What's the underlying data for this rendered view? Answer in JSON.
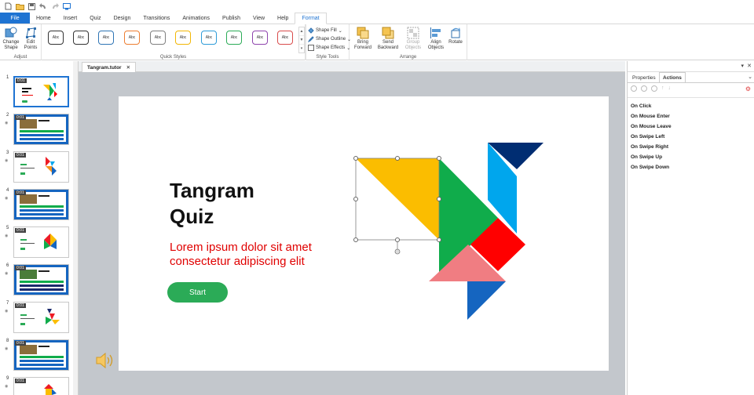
{
  "menu": {
    "file": "File",
    "tabs": [
      "Home",
      "Insert",
      "Quiz",
      "Design",
      "Transitions",
      "Animations",
      "Publish",
      "View",
      "Help",
      "Format"
    ]
  },
  "ribbon": {
    "adjust": {
      "label": "Adjust",
      "change_shape": "Change Shape",
      "edit_points": "Edit Points"
    },
    "quick_styles": {
      "label": "Quick Styles",
      "sample_text": "Abc",
      "border_colors": [
        "#333333",
        "#333333",
        "#2f75b5",
        "#ed7d31",
        "#7f7f7f",
        "#f2b705",
        "#2e9cd8",
        "#2bab57",
        "#1e73d2",
        "#d94c4c"
      ]
    },
    "style_tools": {
      "label": "Style Tools",
      "fill": "Shape Fill",
      "outline": "Shape Outline",
      "effects": "Shape Effects"
    },
    "arrange": {
      "label": "Arrange",
      "bring_forward": "Bring Forward",
      "send_backward": "Send Backward",
      "group": "Group Objects",
      "align": "Align Objects",
      "rotate": "Rotate"
    }
  },
  "document": {
    "tab": "Tangram.tutor",
    "close": "✕"
  },
  "slides": [
    {
      "num": "1",
      "badge": "0:01"
    },
    {
      "num": "2",
      "badge": "0:01"
    },
    {
      "num": "3",
      "badge": "0:01"
    },
    {
      "num": "4",
      "badge": "0:01"
    },
    {
      "num": "5",
      "badge": "0:01"
    },
    {
      "num": "6",
      "badge": "0:01"
    },
    {
      "num": "7",
      "badge": "0:01"
    },
    {
      "num": "8",
      "badge": "0:01"
    },
    {
      "num": "9",
      "badge": "0:01"
    }
  ],
  "slide": {
    "title_line1": "Tangram",
    "title_line2": "Quiz",
    "body_line1": "Lorem ipsum dolor sit amet",
    "body_line2": "consectetur adipiscing elit",
    "button": "Start"
  },
  "panel": {
    "tabs": [
      "Properties",
      "Actions"
    ],
    "triggers": [
      "On Click",
      "On Mouse Enter",
      "On Mouse Leave",
      "On Swipe Left",
      "On Swipe Right",
      "On Swipe Up",
      "On Swipe Down"
    ]
  },
  "colors": {
    "accent": "#1e73d2",
    "start_button": "#2bab57",
    "body_text": "#e00000",
    "canvas_bg": "#c3c7cc",
    "tangram": [
      "#fbbd00",
      "#10ac4b",
      "#00a6ed",
      "#002d72",
      "#ff0000",
      "#f07d82",
      "#1565c0"
    ]
  }
}
